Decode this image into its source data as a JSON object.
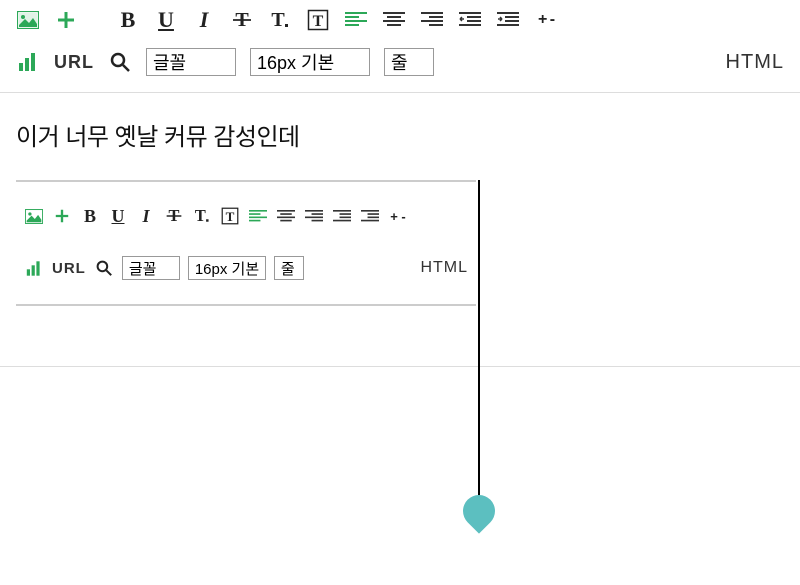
{
  "toolbar": {
    "image_icon": "image",
    "plus_icon": "plus",
    "bold": "B",
    "underline": "U",
    "italic": "I",
    "strike": "T",
    "textsize": "T.",
    "textbox": "T",
    "align_left": "align-left",
    "align_center": "align-center",
    "align_right": "align-right",
    "indent_dec": "indent-dec",
    "indent_inc": "indent-inc",
    "plusminus": "+ -",
    "chart_icon": "chart",
    "url_label": "URL",
    "search_icon": "search",
    "font_value": "글꼴",
    "size_value": "16px 기본",
    "line_value": "줄",
    "html_label": "HTML"
  },
  "content": {
    "text": "이거 너무 옛날 커뮤 감성인데"
  },
  "embedded": {
    "font_value": "글꼴",
    "size_value": "16px 기본",
    "line_value": "줄"
  }
}
